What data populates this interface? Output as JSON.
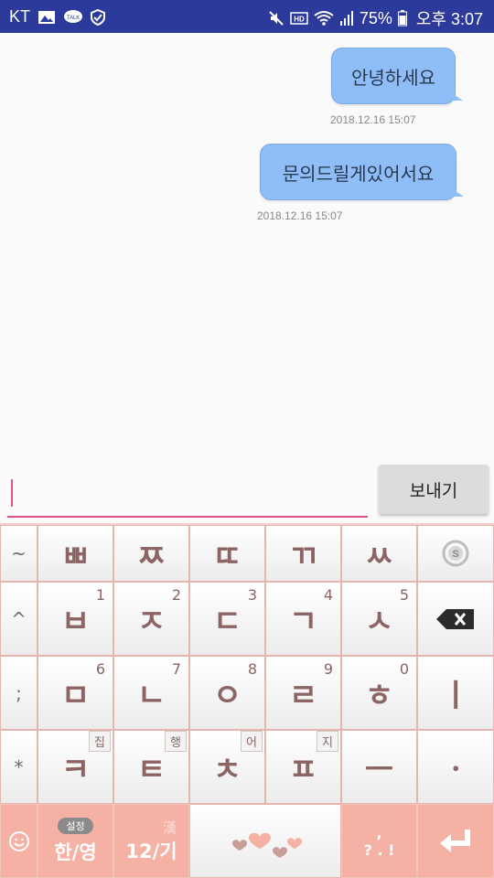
{
  "status_bar": {
    "carrier": "KT",
    "battery": "75%",
    "time": "오후 3:07"
  },
  "messages": [
    {
      "text": "안녕하세요",
      "timestamp": "2018.12.16 15:07"
    },
    {
      "text": "문의드릴게있어서요",
      "timestamp": "2018.12.16 15:07"
    }
  ],
  "input": {
    "value": "",
    "send_label": "보내기"
  },
  "keyboard": {
    "row1": {
      "side": "~",
      "keys": [
        "ㅃ",
        "ㅉ",
        "ㄸ",
        "ㄲ",
        "ㅆ"
      ]
    },
    "row2": {
      "side": "^",
      "keys": [
        "ㅂ",
        "ㅈ",
        "ㄷ",
        "ㄱ",
        "ㅅ"
      ],
      "nums": [
        "1",
        "2",
        "3",
        "4",
        "5"
      ]
    },
    "row3": {
      "side": ";",
      "keys": [
        "ㅁ",
        "ㄴ",
        "ㅇ",
        "ㄹ",
        "ㅎ"
      ],
      "nums": [
        "6",
        "7",
        "8",
        "9",
        "0"
      ],
      "last": "ㅣ"
    },
    "row4": {
      "side": "*",
      "keys": [
        "ㅋ",
        "ㅌ",
        "ㅊ",
        "ㅍ"
      ],
      "tags": [
        "집",
        "행",
        "어",
        "지"
      ],
      "vowel1": "ㅡ",
      "vowel2": "ㆍ"
    },
    "bottom": {
      "settings": "설정",
      "lang": "한/영",
      "hanja": "漢",
      "symbols": "12/기",
      "punct_top": ",",
      "punct_bottom": "? . !"
    }
  },
  "colors": {
    "statusbar": "#2c3a9b",
    "bubble": "#8ebdf8",
    "accent": "#e0508a",
    "keyboard_pink": "#f4b1a4"
  }
}
